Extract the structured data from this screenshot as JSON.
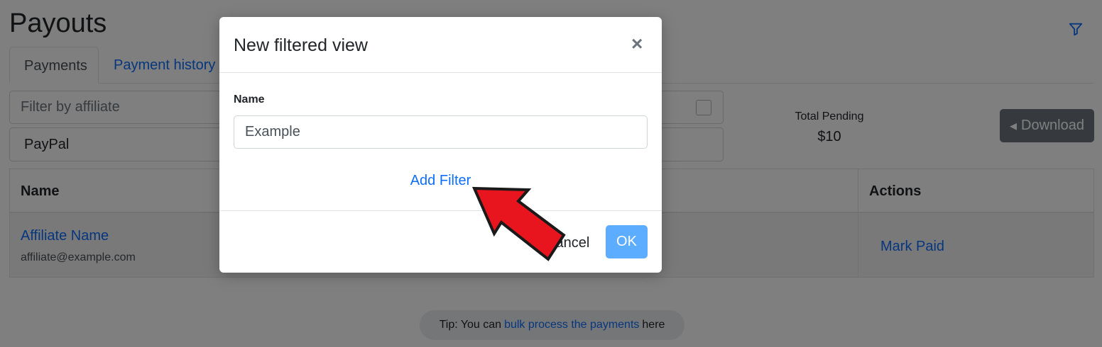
{
  "page": {
    "title": "Payouts",
    "tabs": [
      {
        "label": "Payments",
        "active": true
      },
      {
        "label": "Payment history",
        "active": false
      }
    ],
    "filters": {
      "affiliate_placeholder": "Filter by affiliate",
      "method_value": "PayPal"
    },
    "summary": {
      "label": "Total Pending",
      "value": "$10"
    },
    "download_label": "Download",
    "table": {
      "columns": [
        "Name",
        "Actions"
      ],
      "rows": [
        {
          "name": "Affiliate Name",
          "email": "affiliate@example.com",
          "action": "Mark Paid"
        }
      ]
    },
    "tip": {
      "prefix": "Tip: You can",
      "link": "bulk process the payments",
      "suffix": "here"
    }
  },
  "modal": {
    "title": "New filtered view",
    "close_symbol": "×",
    "name_label": "Name",
    "name_value": "Example",
    "add_filter_label": "Add Filter",
    "cancel_label": "Cancel",
    "ok_label": "OK"
  },
  "colors": {
    "link": "#0d6efd",
    "download_bg": "#6c757d",
    "ok_bg": "#5cacff",
    "annotation_arrow": "#e8141e"
  },
  "icons": [
    "filter-icon",
    "close-icon",
    "caret-left-icon",
    "spinner-icon",
    "red-arrow-annotation"
  ]
}
